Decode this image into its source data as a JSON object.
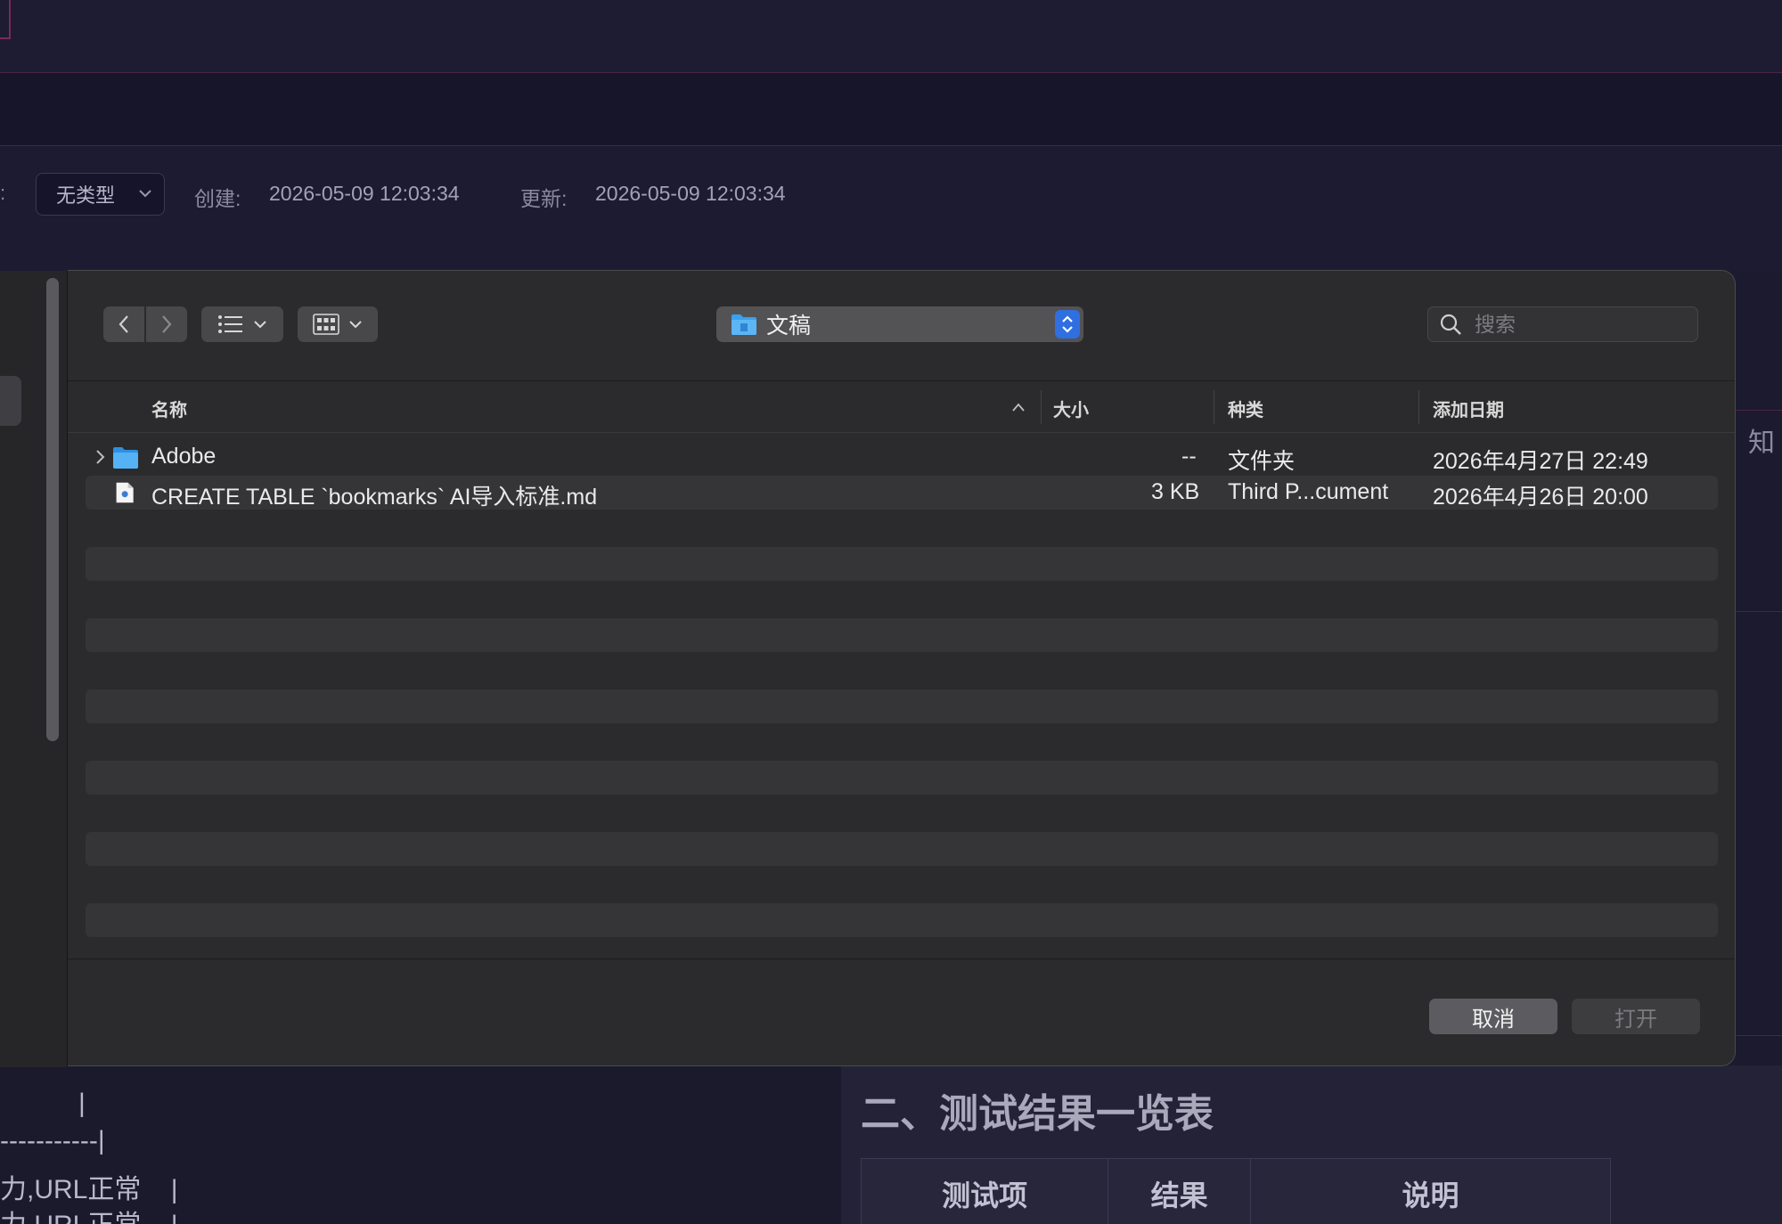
{
  "background": {
    "meta": {
      "type_select_value": "无类型",
      "created_label": "创建:",
      "created_value": "2026-05-09 12:03:34",
      "updated_label": "更新:",
      "updated_value": "2026-05-09 12:03:34"
    },
    "right_edge_char": "知",
    "code_lines": [
      "|",
      "-----------|",
      "力,URL正常    |",
      "力,URL正常    |"
    ],
    "section_title": "二、测试结果一览表",
    "table_headers": [
      "测试项",
      "结果",
      "说明"
    ]
  },
  "dialog": {
    "location": "文稿",
    "search_placeholder": "搜索",
    "columns": {
      "name": "名称",
      "size": "大小",
      "kind": "种类",
      "date_added": "添加日期"
    },
    "files": [
      {
        "name": "Adobe",
        "size": "--",
        "kind": "文件夹",
        "date": "2026年4月27日 22:49",
        "icon": "folder-icon"
      },
      {
        "name": "CREATE TABLE `bookmarks` AI导入标准.md",
        "size": "3 KB",
        "kind": "Third P...cument",
        "date": "2026年4月26日 20:00",
        "icon": "document-icon"
      }
    ],
    "buttons": {
      "cancel": "取消",
      "open": "打开"
    }
  },
  "colors": {
    "accent_blue": "#2f6fe0",
    "folder_blue": "#3aa0f0",
    "dialog_bg": "#2b2b2d",
    "app_bg": "#1c1a2e"
  }
}
